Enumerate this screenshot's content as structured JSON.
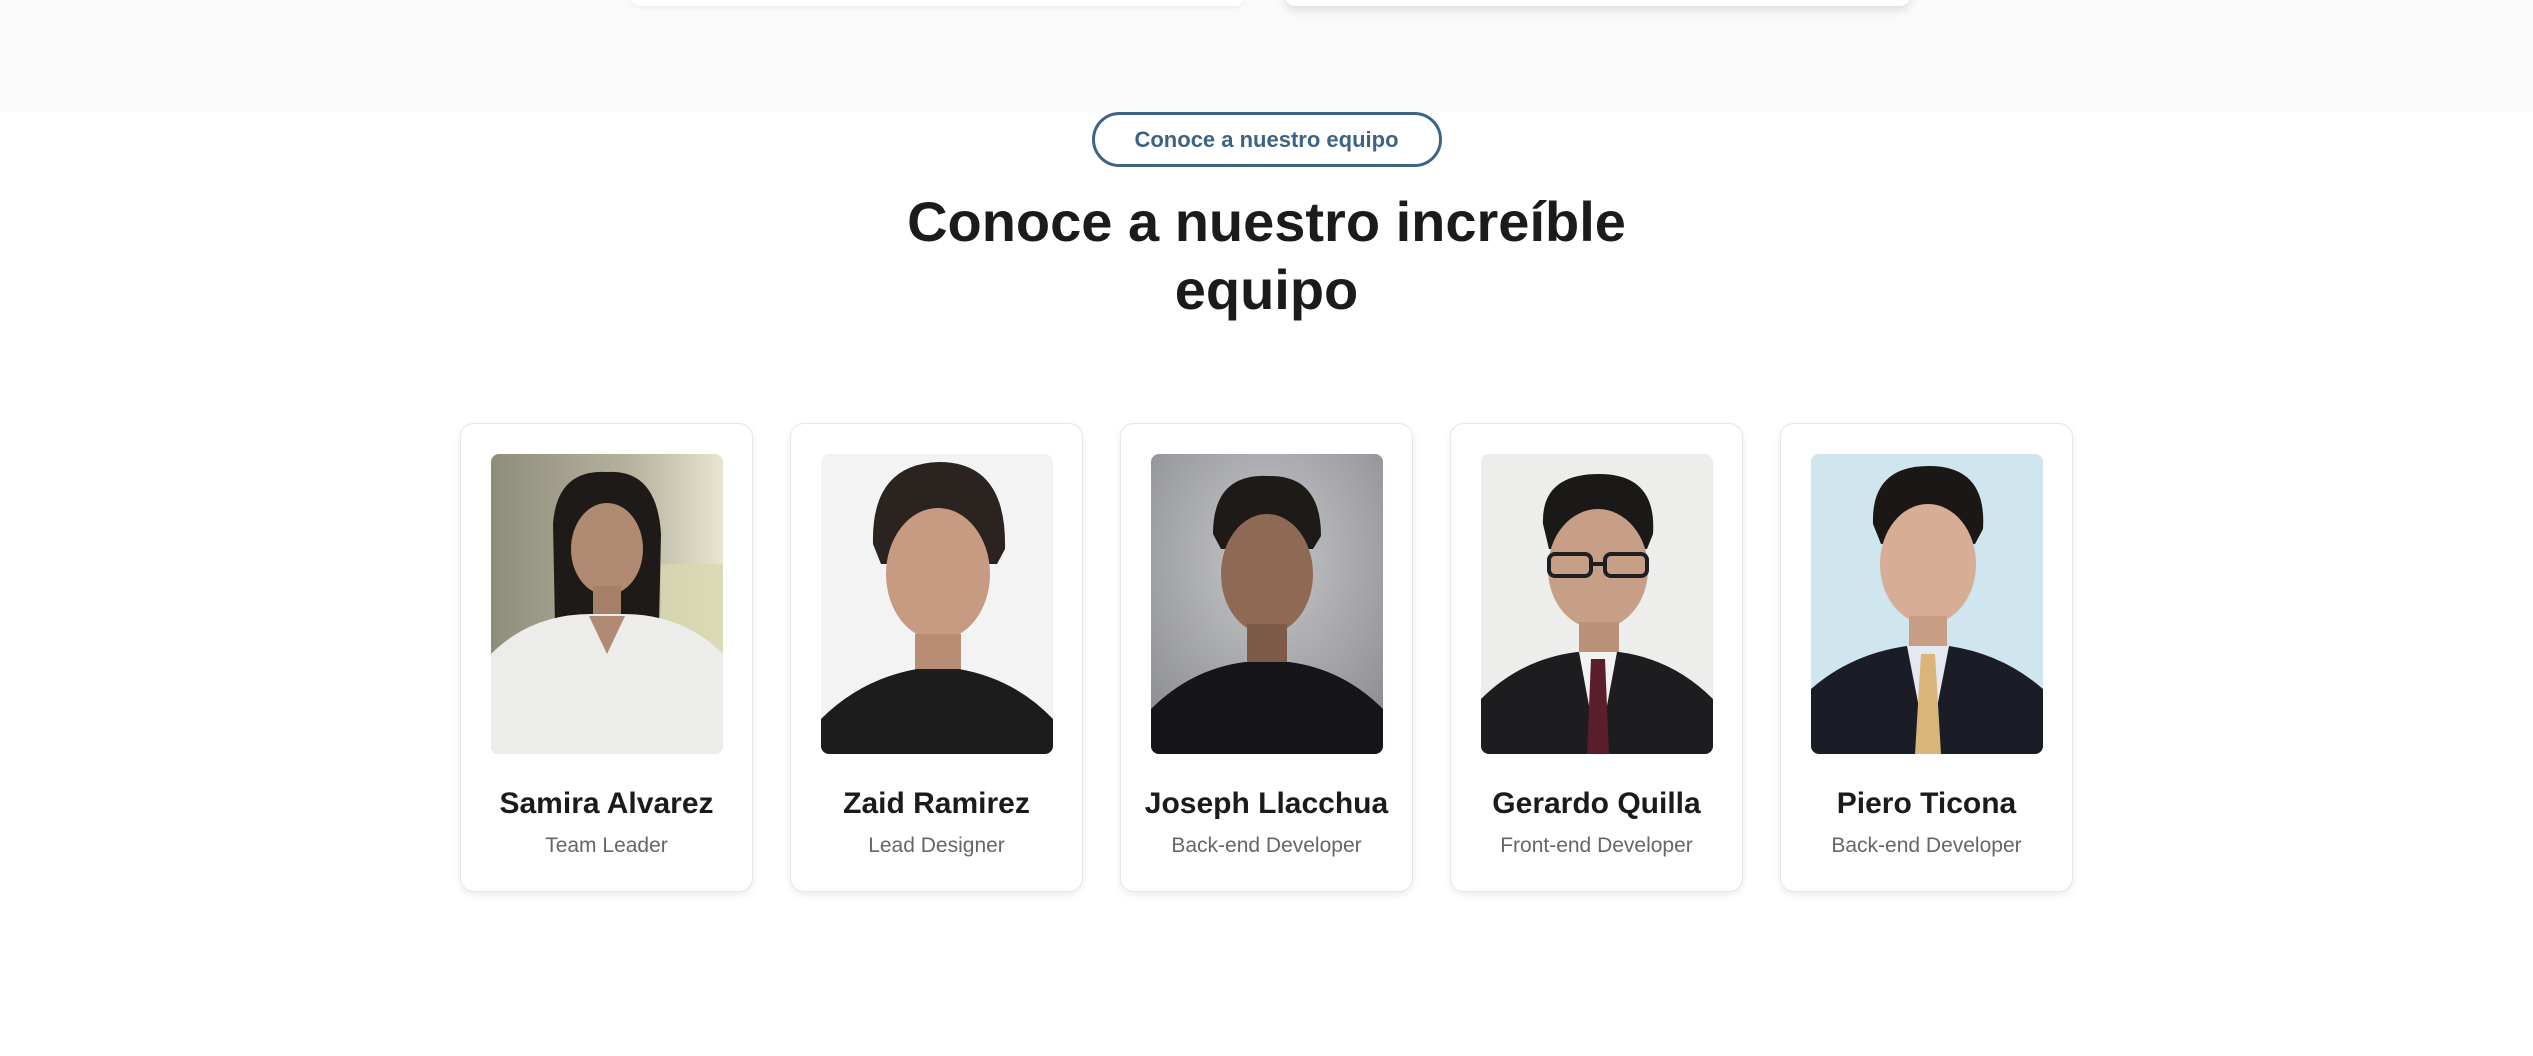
{
  "section": {
    "pill_label": "Conoce a nuestro equipo",
    "heading_line1": "Conoce a nuestro increíble",
    "heading_line2": "equipo"
  },
  "team": [
    {
      "name": "Samira Alvarez",
      "role": "Team Leader"
    },
    {
      "name": "Zaid Ramirez",
      "role": "Lead Designer"
    },
    {
      "name": "Joseph Llacchua",
      "role": "Back-end Developer"
    },
    {
      "name": "Gerardo Quilla",
      "role": "Front-end Developer"
    },
    {
      "name": "Piero Ticona",
      "role": "Back-end Developer"
    }
  ],
  "colors": {
    "accent": "#3d6485",
    "heading": "#1b1b1b",
    "muted": "#666666",
    "band": "#fafafa"
  }
}
